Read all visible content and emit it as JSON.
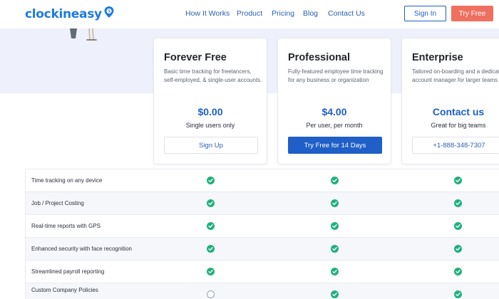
{
  "header": {
    "logo_text": "clockineasy",
    "nav": [
      "How It Works",
      "Product",
      "Pricing",
      "Blog",
      "Contact Us"
    ],
    "signin_label": "Sign In",
    "tryfree_label": "Try Free"
  },
  "plans": [
    {
      "name": "Forever Free",
      "description": "Basic time tracking for freelancers, self-employed, & single-user accounts.",
      "price": "$0.00",
      "subtitle": "Single users only",
      "button": "Sign Up",
      "primary": false
    },
    {
      "name": "Professional",
      "description": "Fully-featured employee time tracking for any business or organization",
      "price": "$4.00",
      "subtitle": "Per user, per month",
      "button": "Try Free for 14 Days",
      "primary": true
    },
    {
      "name": "Enterprise",
      "description": "Tailored on-boarding and a dedicated account manager for larger teams",
      "price": "Contact us",
      "subtitle": "Great for big teams",
      "button": "+1-888-348-7307",
      "primary": false
    }
  ],
  "features": [
    {
      "label": "Time tracking on any device",
      "checks": [
        true,
        true,
        true
      ]
    },
    {
      "label": "Job / Project Costing",
      "checks": [
        true,
        true,
        true
      ]
    },
    {
      "label": "Real-time reports with GPS",
      "checks": [
        true,
        true,
        true
      ]
    },
    {
      "label": "Enhanced security with face recognition",
      "checks": [
        true,
        true,
        true
      ]
    },
    {
      "label": "Streamlined payroll reporting",
      "checks": [
        true,
        true,
        true
      ]
    },
    {
      "label": "Custom Company Policies",
      "checks": [
        false,
        true,
        true
      ]
    }
  ],
  "colors": {
    "brand": "#1f7ae0",
    "primary": "#1f5fc7",
    "accent": "#f07060",
    "check": "#22b07d"
  }
}
